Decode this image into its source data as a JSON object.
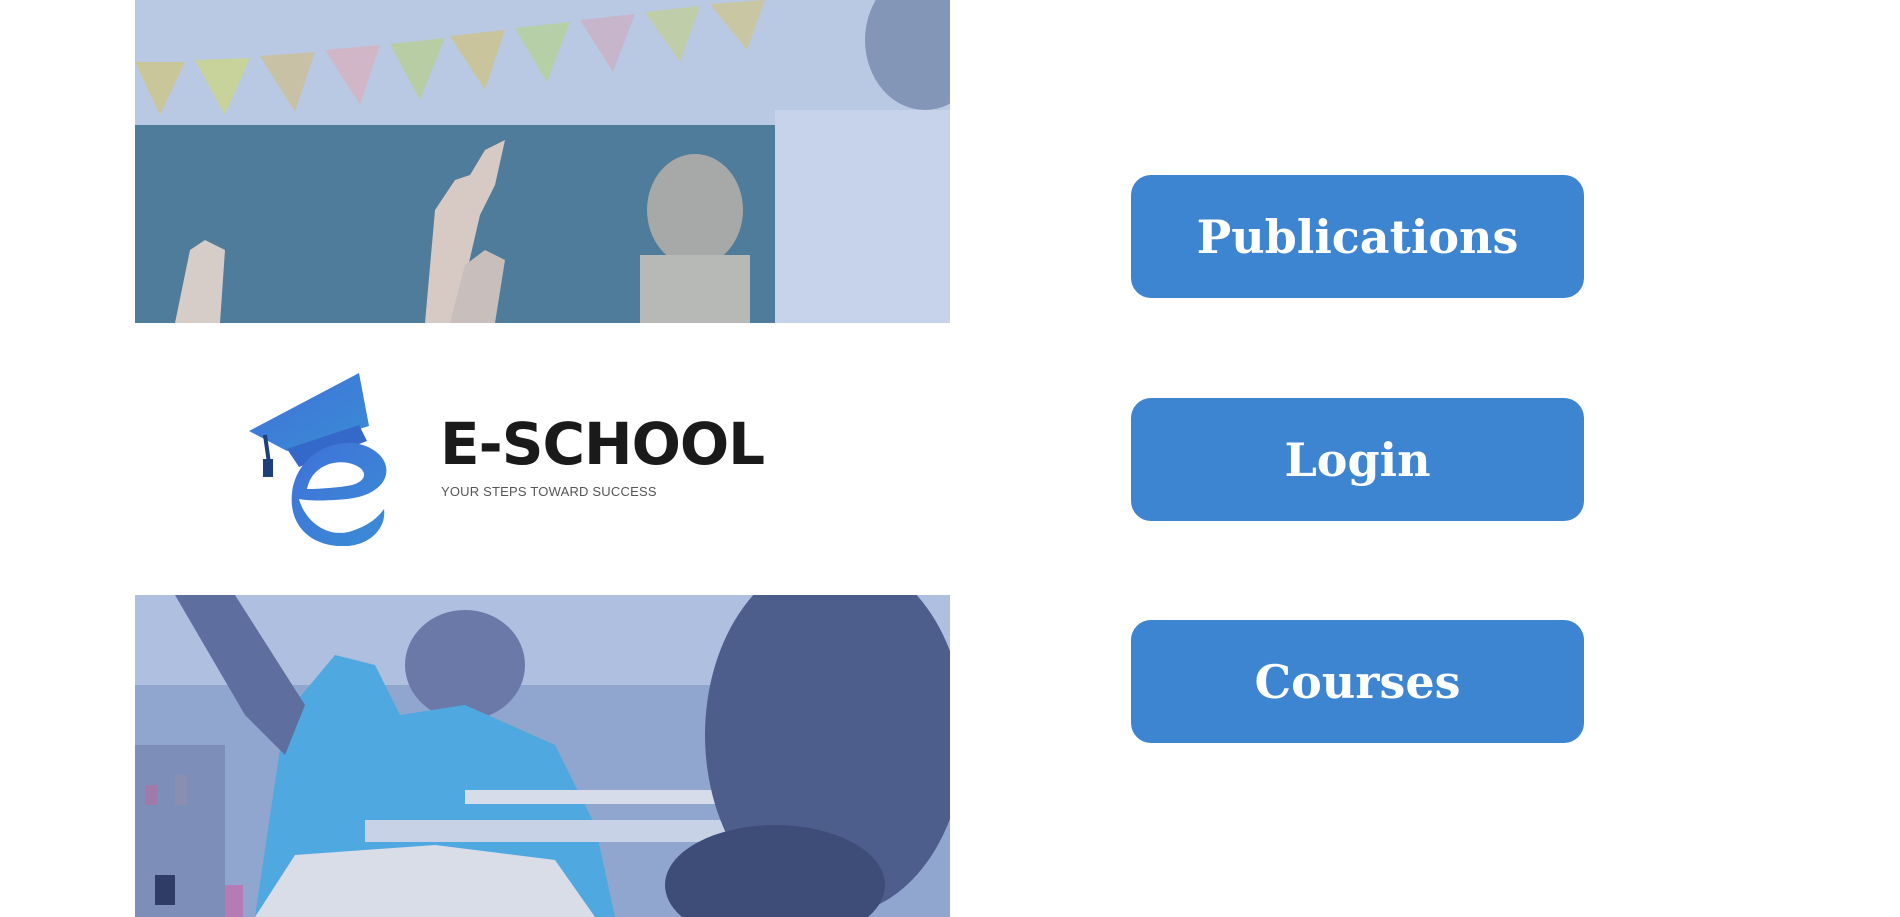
{
  "brand": {
    "name": "E-SCHOOL",
    "tagline": "YOUR STEPS TOWARD SUCCESS",
    "logo_icon": "graduation-cap-e-icon",
    "logo_color": "#3d7fd6"
  },
  "images": {
    "top": "classroom-raised-hands-photo",
    "bottom": "student-raising-hand-photo"
  },
  "nav": {
    "publications_label": "Publications",
    "login_label": "Login",
    "courses_label": "Courses"
  },
  "colors": {
    "button": "#3d85d0",
    "button_text": "#ffffff",
    "photo_overlay": "#4a78c0"
  }
}
